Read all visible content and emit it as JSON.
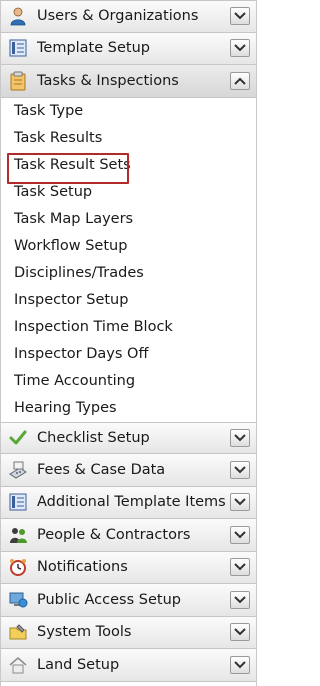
{
  "sections": [
    {
      "label": "Users & Organizations",
      "icon": "user-icon"
    },
    {
      "label": "Template Setup",
      "icon": "template-icon"
    },
    {
      "label": "Tasks & Inspections",
      "icon": "clipboard-icon",
      "expanded": true
    },
    {
      "label": "Checklist Setup",
      "icon": "checkmark-icon"
    },
    {
      "label": "Fees & Case Data",
      "icon": "calculator-icon"
    },
    {
      "label": "Additional Template Items",
      "icon": "template-icon"
    },
    {
      "label": "People & Contractors",
      "icon": "people-icon"
    },
    {
      "label": "Notifications",
      "icon": "alarm-clock-icon"
    },
    {
      "label": "Public Access Setup",
      "icon": "computer-icon"
    },
    {
      "label": "System Tools",
      "icon": "folder-tools-icon"
    },
    {
      "label": "Land Setup",
      "icon": "house-icon"
    }
  ],
  "tasks_items": [
    "Task Type",
    "Task Results",
    "Task Result Sets",
    "Task Setup",
    "Task Map Layers",
    "Workflow Setup",
    "Disciplines/Trades",
    "Inspector Setup",
    "Inspection Time Block",
    "Inspector Days Off",
    "Time Accounting",
    "Hearing Types"
  ],
  "selected_item": "Task Result Sets",
  "colors": {
    "selection_border": "#b22a2a"
  }
}
